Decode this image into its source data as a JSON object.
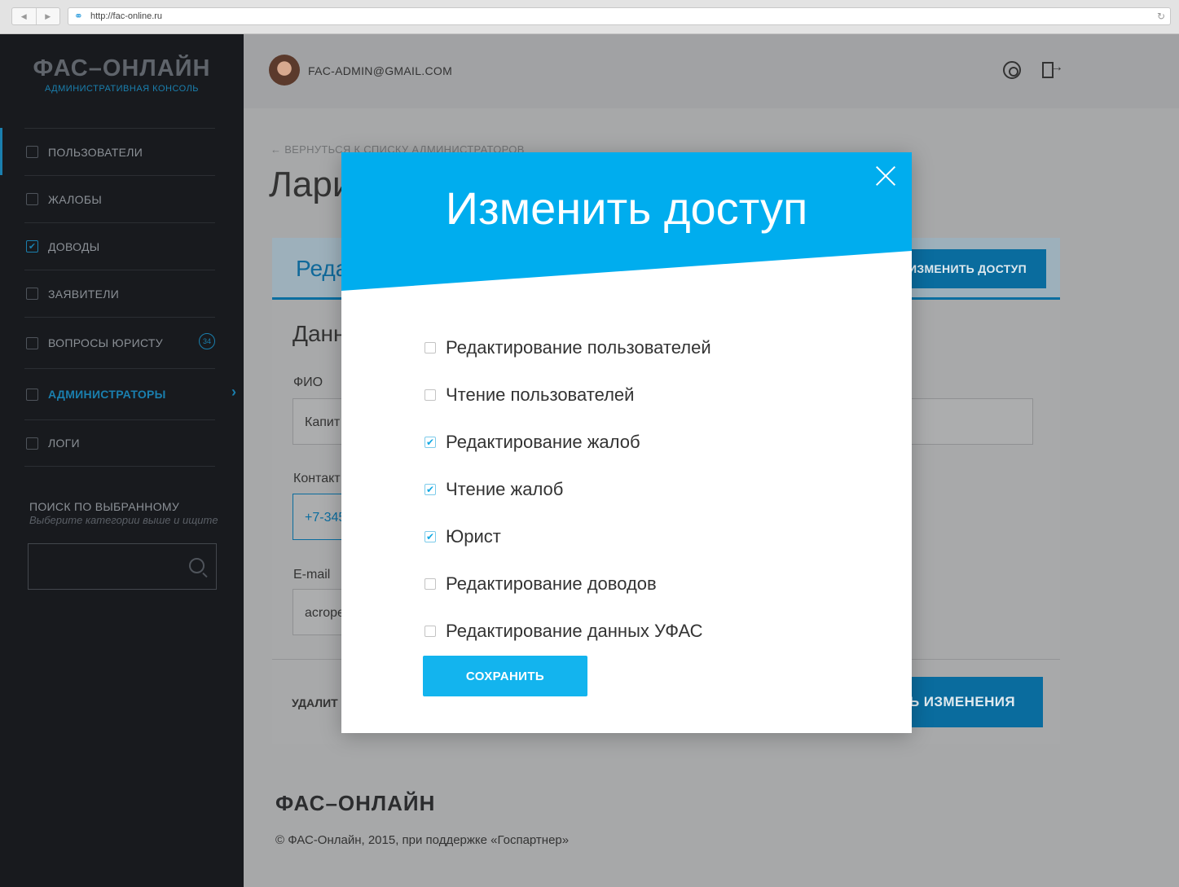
{
  "browser": {
    "url": "http://fac-online.ru",
    "back_glyph": "◀",
    "forward_glyph": "▶",
    "link_glyph": "⚭",
    "reload_glyph": "↻"
  },
  "sidebar": {
    "logo": "ФАС–ОНЛАЙН",
    "logo_sub": "АДМИНИСТРАТИВНАЯ КОНСОЛЬ",
    "items": [
      {
        "label": "ПОЛЬЗОВАТЕЛИ",
        "checked": false
      },
      {
        "label": "ЖАЛОБЫ",
        "checked": false
      },
      {
        "label": "ДОВОДЫ",
        "checked": true
      },
      {
        "label": "ЗАЯВИТЕЛИ",
        "checked": false
      },
      {
        "label": "ВОПРОСЫ ЮРИСТУ",
        "checked": false,
        "badge": "34"
      },
      {
        "label": "АДМИНИСТРАТОРЫ",
        "checked": false,
        "active": true
      },
      {
        "label": "ЛОГИ",
        "checked": false
      }
    ],
    "check_glyph": "✔",
    "chevron_glyph": "›",
    "search_title": "ПОИСК ПО ВЫБРАННОМУ",
    "search_hint": "Выберите категории выше и ищите",
    "accent_color": "#1a7fae"
  },
  "topbar": {
    "email": "FAC-ADMIN@GMAIL.COM"
  },
  "page": {
    "back_link": "← ВЕРНУТЬСЯ К СПИСКУ АДМИНИСТРАТОРОВ",
    "title": "Лари",
    "card_title": "Реда",
    "access_button": "ИЗМЕНИТЬ ДОСТУП",
    "section_title": "Данн",
    "fio_label": "ФИО",
    "fio_value": "Капит",
    "contact_label": "Контакт",
    "contact_value": "+7-345",
    "email_label": "E-mail",
    "email_value": "acrope",
    "delete_link": "УДАЛИТ",
    "save_changes": "Ь ИЗМЕНЕНИЯ"
  },
  "footer": {
    "logo": "ФАС–ОНЛАЙН",
    "copyright": "© ФАС-Онлайн, 2015, при поддержке «Госпартнер»"
  },
  "modal": {
    "title": "Изменить доступ",
    "header_color": "#00adee",
    "check_glyph": "✔",
    "permissions": [
      {
        "label": "Редактирование пользователей",
        "checked": false
      },
      {
        "label": "Чтение пользователей",
        "checked": false
      },
      {
        "label": "Редактирование жалоб",
        "checked": true
      },
      {
        "label": "Чтение жалоб",
        "checked": true
      },
      {
        "label": "Юрист",
        "checked": true
      },
      {
        "label": "Редактирование доводов",
        "checked": false
      },
      {
        "label": "Редактирование данных УФАС",
        "checked": false
      }
    ],
    "save_button": "СОХРАНИТЬ"
  }
}
